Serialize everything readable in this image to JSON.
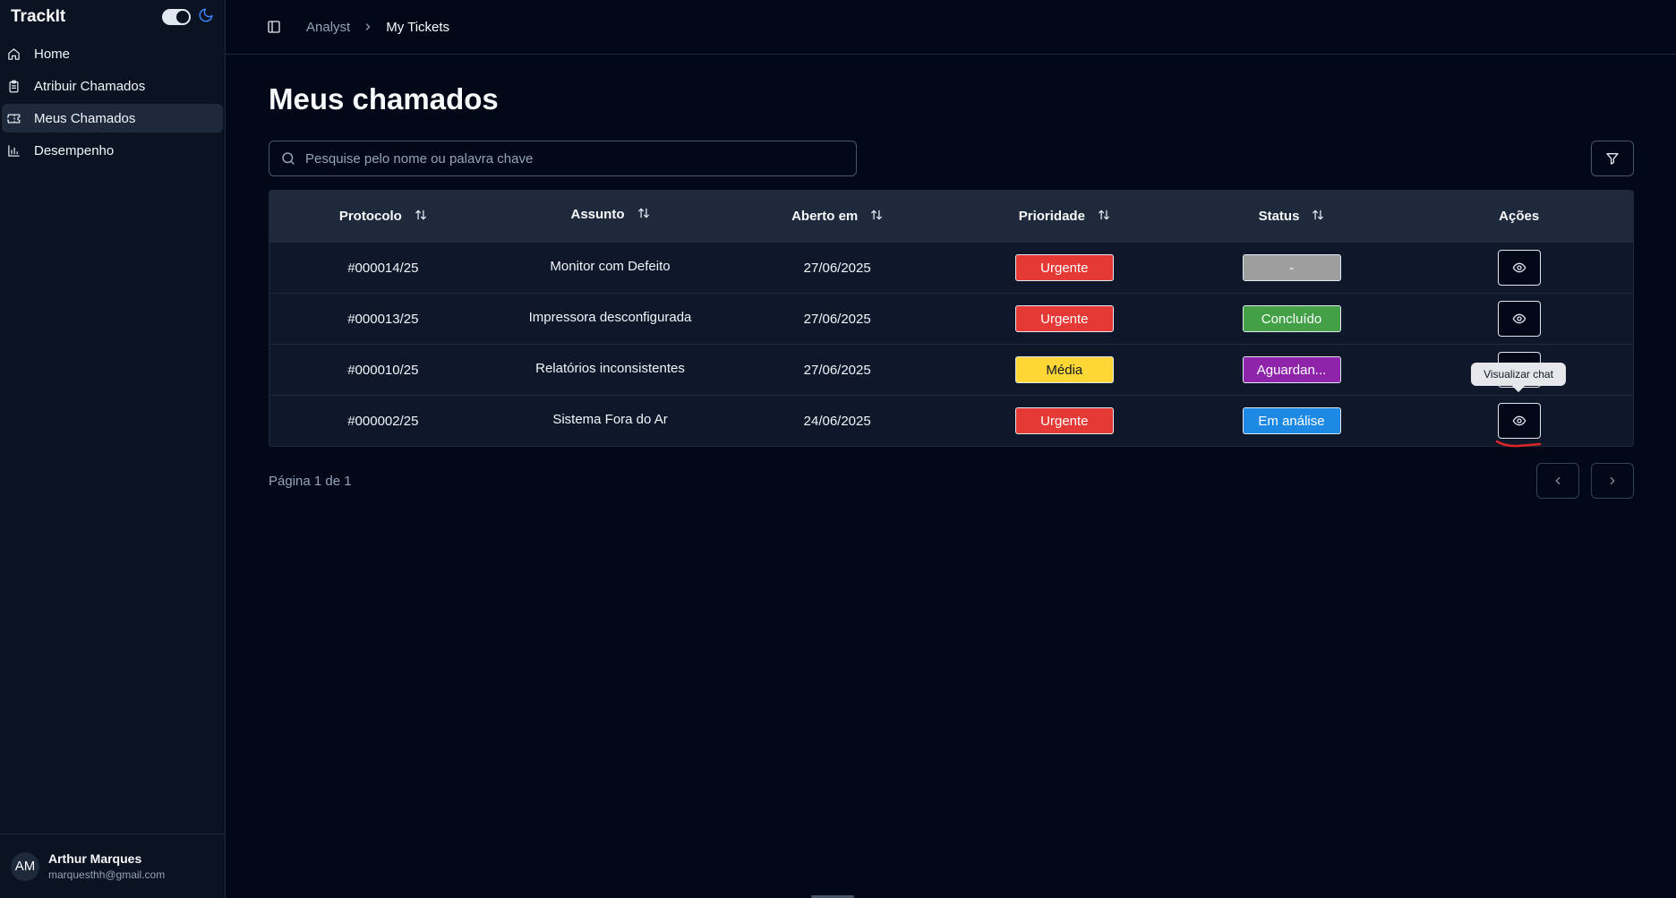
{
  "app": {
    "title": "TrackIt"
  },
  "sidebar": {
    "items": [
      {
        "label": "Home",
        "icon": "home-icon"
      },
      {
        "label": "Atribuir Chamados",
        "icon": "clipboard-icon"
      },
      {
        "label": "Meus Chamados",
        "icon": "ticket-icon",
        "active": true
      },
      {
        "label": "Desempenho",
        "icon": "bar-chart-icon"
      }
    ],
    "user": {
      "initials": "AM",
      "name": "Arthur Marques",
      "email": "marquesthh@gmail.com"
    }
  },
  "header": {
    "breadcrumb": [
      "Analyst",
      "My Tickets"
    ]
  },
  "main": {
    "title": "Meus chamados",
    "search": {
      "placeholder": "Pesquise pelo nome ou palavra chave",
      "value": ""
    },
    "columns": [
      "Protocolo",
      "Assunto",
      "Aberto em",
      "Prioridade",
      "Status",
      "Ações"
    ],
    "rows": [
      {
        "protocol": "#000014/25",
        "subject": "Monitor com Defeito",
        "opened": "27/06/2025",
        "priority": "Urgente",
        "status": "-"
      },
      {
        "protocol": "#000013/25",
        "subject": "Impressora desconfigurada",
        "opened": "27/06/2025",
        "priority": "Urgente",
        "status": "Concluído"
      },
      {
        "protocol": "#000010/25",
        "subject": "Relatórios inconsistentes",
        "opened": "27/06/2025",
        "priority": "Média",
        "status": "Aguardan..."
      },
      {
        "protocol": "#000002/25",
        "subject": "Sistema Fora do Ar",
        "opened": "24/06/2025",
        "priority": "Urgente",
        "status": "Em análise"
      }
    ],
    "tooltip": "Visualizar chat",
    "pagination": {
      "info": "Página 1 de 1"
    }
  },
  "colors": {
    "background": "#020817",
    "urgent": "#e53935",
    "medium": "#fdd835",
    "status_none": "#9e9e9e",
    "status_done": "#43a047",
    "status_waiting": "#8e24aa",
    "status_analysis": "#1e88e5"
  }
}
